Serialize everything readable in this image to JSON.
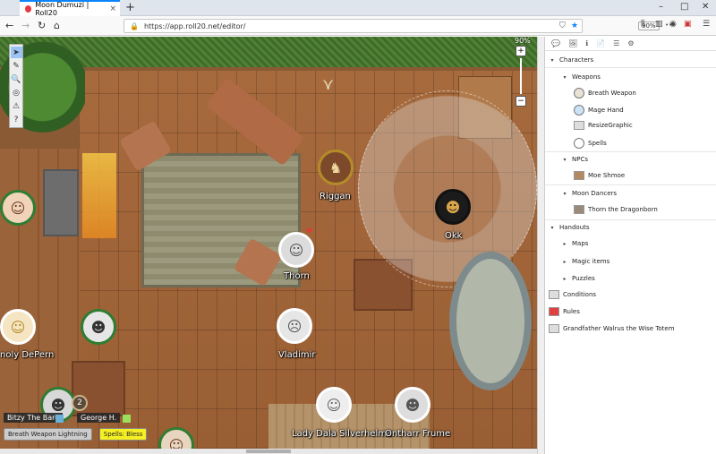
{
  "browser": {
    "tab_title": "Moon Dumuzi | Roll20",
    "new_tab": "+",
    "tab_close": "×",
    "minimize": "–",
    "maximize": "□",
    "close": "✕",
    "back": "←",
    "forward": "→",
    "reload": "↻",
    "home": "⌂",
    "url": "https://app.roll20.net/editor/",
    "zoom": "90%",
    "lock": "🔒",
    "url_more": "•••",
    "pocket": "⛉",
    "star": "★",
    "library": "⫼",
    "sidebar": "▥",
    "reader": "≡",
    "account": "◉",
    "extension_badge": "9",
    "extension": "▣",
    "menu": "☰"
  },
  "map": {
    "zoom_label": "90%",
    "zoom_plus": "+",
    "zoom_minus": "−",
    "antler": "⋎",
    "tools": [
      {
        "glyph": "➤",
        "name": "select-tool-icon",
        "active": true
      },
      {
        "glyph": "✎",
        "name": "draw-tool-icon",
        "active": false
      },
      {
        "glyph": "🔍",
        "name": "zoom-tool-icon",
        "active": false
      },
      {
        "glyph": "◎",
        "name": "measure-tool-icon",
        "active": false
      },
      {
        "glyph": "⚠",
        "name": "fog-tool-icon",
        "active": false
      },
      {
        "glyph": "?",
        "name": "help-tool-icon",
        "active": false
      }
    ],
    "tokens": {
      "riggan": "Riggan",
      "okk": "Okk",
      "thorn": "Thorn",
      "vladimir": "Vladimir",
      "noly": "noly DePern",
      "lady_dala": "Lady Dala Silverhelme",
      "ontharr": "Ontharr Frume"
    },
    "token_faces": {
      "riggan": "♞",
      "okk": "☻",
      "thorn": "☺",
      "vladimir": "☹",
      "noly": "☺",
      "lady_dala": "☺",
      "ontharr": "☻",
      "player_left": "☺",
      "player_mid": "☻",
      "player_bottom_left": "☻",
      "player_bottom": "☺"
    },
    "thorn_status": "❤",
    "counter": "2",
    "players": [
      {
        "name": "Bitzy The Bard",
        "color": "#6ab0d8"
      },
      {
        "name": "George H.",
        "color": "#9ae05a"
      }
    ],
    "macros": [
      {
        "label": "Breath Weapon Lightning",
        "highlight": false
      },
      {
        "label": "Spells: Bless",
        "highlight": true
      }
    ]
  },
  "panel": {
    "tabs": [
      "💬",
      "🖼",
      "ℹ",
      "📄",
      "☰",
      "⚙"
    ],
    "characters": "Characters",
    "weapons": "Weapons",
    "breath_weapon": "Breath Weapon",
    "mage_hand": "Mage Hand",
    "resize_graphic": "ResizeGraphic",
    "spells": "Spells",
    "npcs": "NPCs",
    "moe_shmoe": "Moe Shmoe",
    "moon_dancers": "Moon Dancers",
    "thorn_dragonborn": "Thorn the Dragonborn",
    "handouts": "Handouts",
    "maps": "Maps",
    "magic_items": "Magic items",
    "puzzles": "Puzzles",
    "conditions": "Conditions",
    "rules": "Rules",
    "grandfather": "Grandfather Walrus the Wise Totem",
    "caret_open": "▾",
    "caret_closed": "▸"
  },
  "colors": {
    "accent": "#0a84ff",
    "macro_highlight": "#f5f023"
  }
}
